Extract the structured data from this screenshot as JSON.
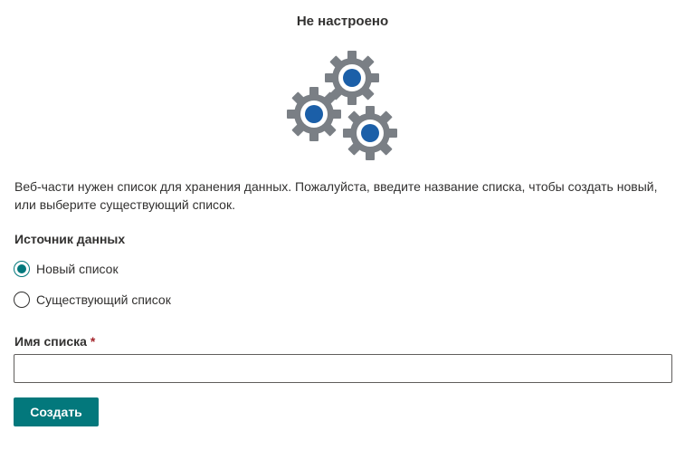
{
  "header": {
    "title": "Не настроено",
    "illustration_icon": "gears-icon"
  },
  "description": "Веб-части нужен список для хранения данных. Пожалуйста, введите название списка, чтобы создать новый, или выберите существующий список.",
  "data_source": {
    "label": "Источник данных",
    "options": [
      {
        "label": "Новый список",
        "selected": true
      },
      {
        "label": "Существующий список",
        "selected": false
      }
    ]
  },
  "list_name": {
    "label": "Имя списка",
    "required_marker": "*",
    "value": "",
    "placeholder": ""
  },
  "actions": {
    "create_label": "Создать"
  },
  "colors": {
    "accent": "#03787c",
    "gear_gray": "#7a7f85",
    "gear_center": "#1b5fa8",
    "required": "#a4262c",
    "text": "#323130"
  }
}
